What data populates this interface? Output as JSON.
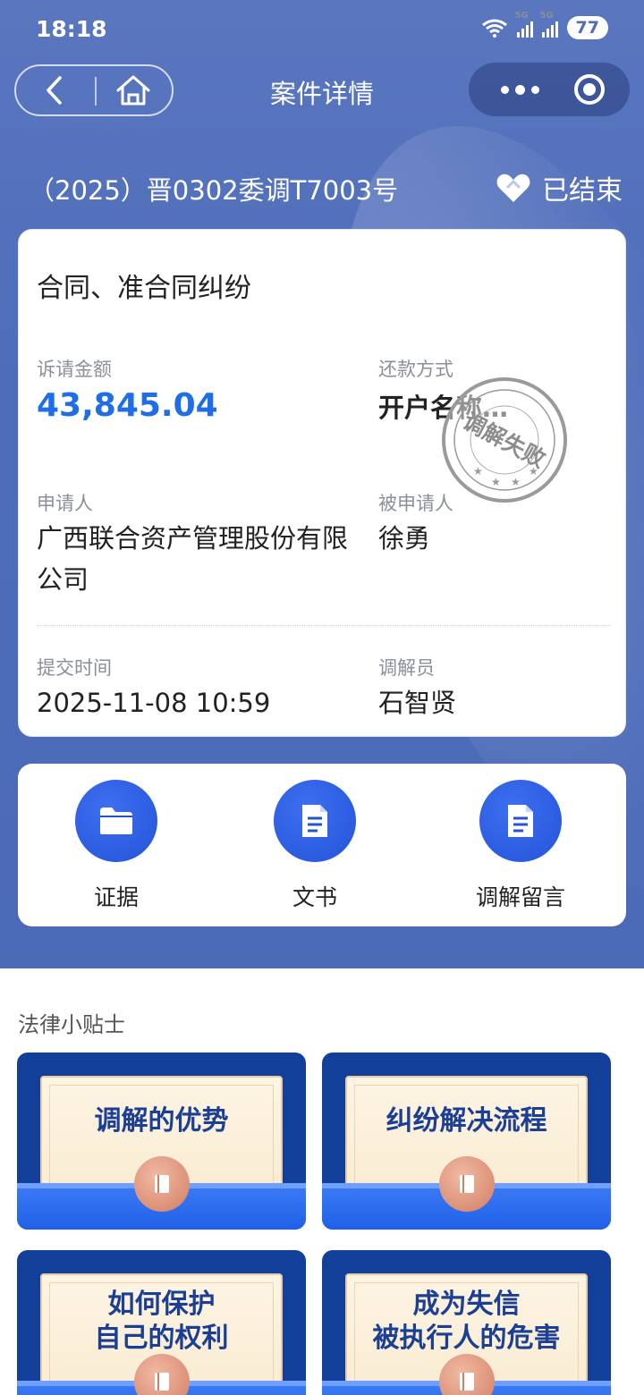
{
  "status_bar": {
    "time": "18:18",
    "network_1": "5G",
    "network_2": "5G",
    "battery": "77"
  },
  "nav": {
    "title": "案件详情"
  },
  "case": {
    "number": "（2025）晋0302委调T7003号",
    "status": "已结束",
    "type": "合同、准合同纠纷",
    "amount_label": "诉请金额",
    "amount_value": "43,845.04",
    "repay_label": "还款方式",
    "repay_value": "开户名称…",
    "applicant_label": "申请人",
    "applicant_value": "广西联合资产管理股份有限公司",
    "respondent_label": "被申请人",
    "respondent_value": "徐勇",
    "submit_time_label": "提交时间",
    "submit_time_value": "2025-11-08 10:59",
    "mediator_label": "调解员",
    "mediator_value": "石智贤",
    "stamp_text": "调解失败"
  },
  "actions": [
    {
      "label": "证据",
      "icon": "folder-icon"
    },
    {
      "label": "文书",
      "icon": "document-icon"
    },
    {
      "label": "调解留言",
      "icon": "document-icon"
    }
  ],
  "tips": {
    "title": "法律小贴士",
    "items": [
      {
        "line1": "调解的优势",
        "line2": ""
      },
      {
        "line1": "纠纷解决流程",
        "line2": ""
      },
      {
        "line1": "如何保护",
        "line2": "自己的权利"
      },
      {
        "line1": "成为失信",
        "line2": "被执行人的危害"
      }
    ]
  },
  "colors": {
    "header_blue": "#4e6cba",
    "amount_blue": "#1f6ee8",
    "icon_blue": "#2453d8",
    "tip_navy": "#123f9a"
  }
}
